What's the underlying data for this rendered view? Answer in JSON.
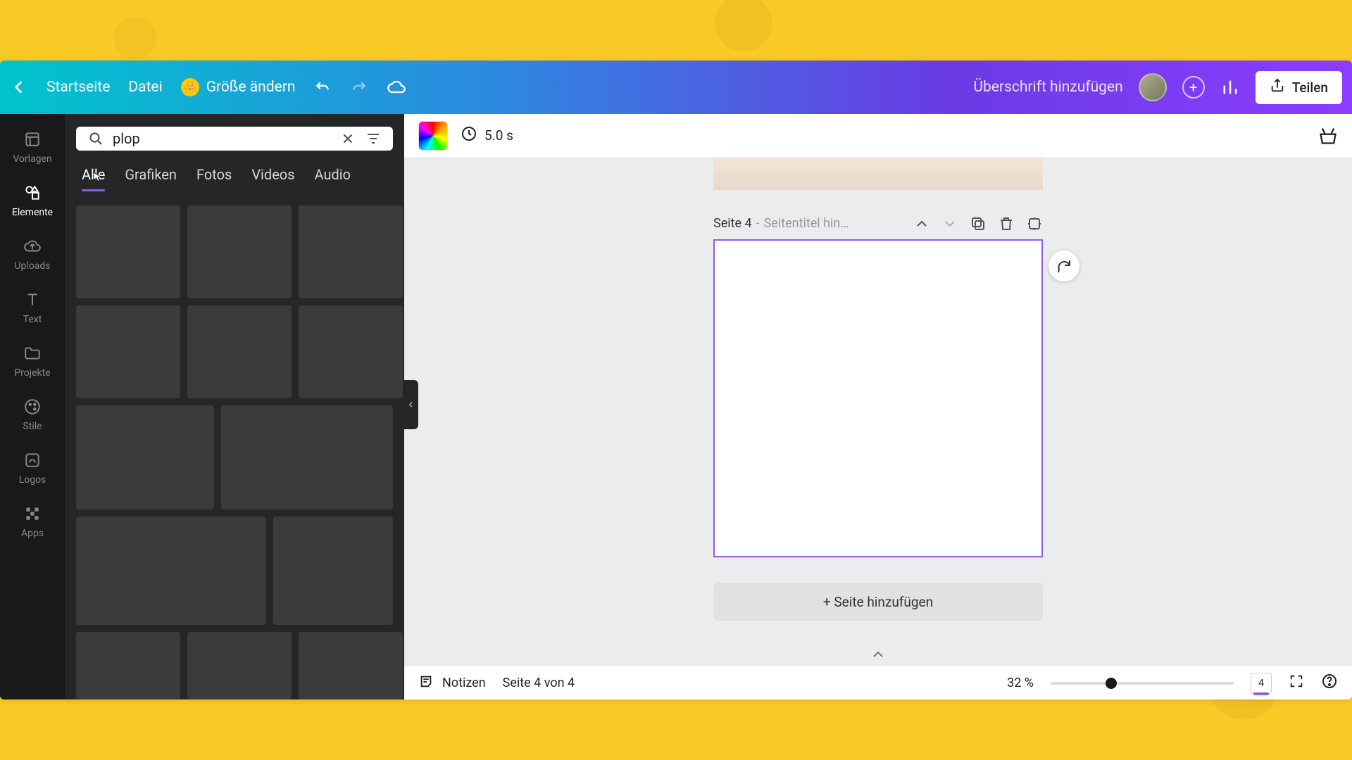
{
  "header": {
    "back": "Startseite",
    "file": "Datei",
    "resize": "Größe ändern",
    "title_placeholder": "Überschrift hinzufügen",
    "share": "Teilen"
  },
  "rail": {
    "items": [
      {
        "id": "templates",
        "label": "Vorlagen"
      },
      {
        "id": "elements",
        "label": "Elemente"
      },
      {
        "id": "uploads",
        "label": "Uploads"
      },
      {
        "id": "text",
        "label": "Text"
      },
      {
        "id": "projects",
        "label": "Projekte"
      },
      {
        "id": "styles",
        "label": "Stile"
      },
      {
        "id": "logos",
        "label": "Logos"
      },
      {
        "id": "apps",
        "label": "Apps"
      }
    ]
  },
  "panel": {
    "search_value": "plop",
    "tabs": [
      "Alle",
      "Grafiken",
      "Fotos",
      "Videos",
      "Audio"
    ],
    "active_tab": 0
  },
  "canvas": {
    "duration": "5.0 s",
    "page_label_prefix": "Seite 4",
    "page_label_sep": " - ",
    "page_title_placeholder": "Seitentitel hin…",
    "add_page": "+ Seite hinzufügen"
  },
  "bottombar": {
    "notes": "Notizen",
    "page_of": "Seite 4 von 4",
    "zoom_label": "32 %",
    "zoom_value": 32,
    "zoom_min": 0,
    "zoom_max": 200,
    "page_badge": "4"
  },
  "colors": {
    "accent": "#8b5cf6"
  }
}
